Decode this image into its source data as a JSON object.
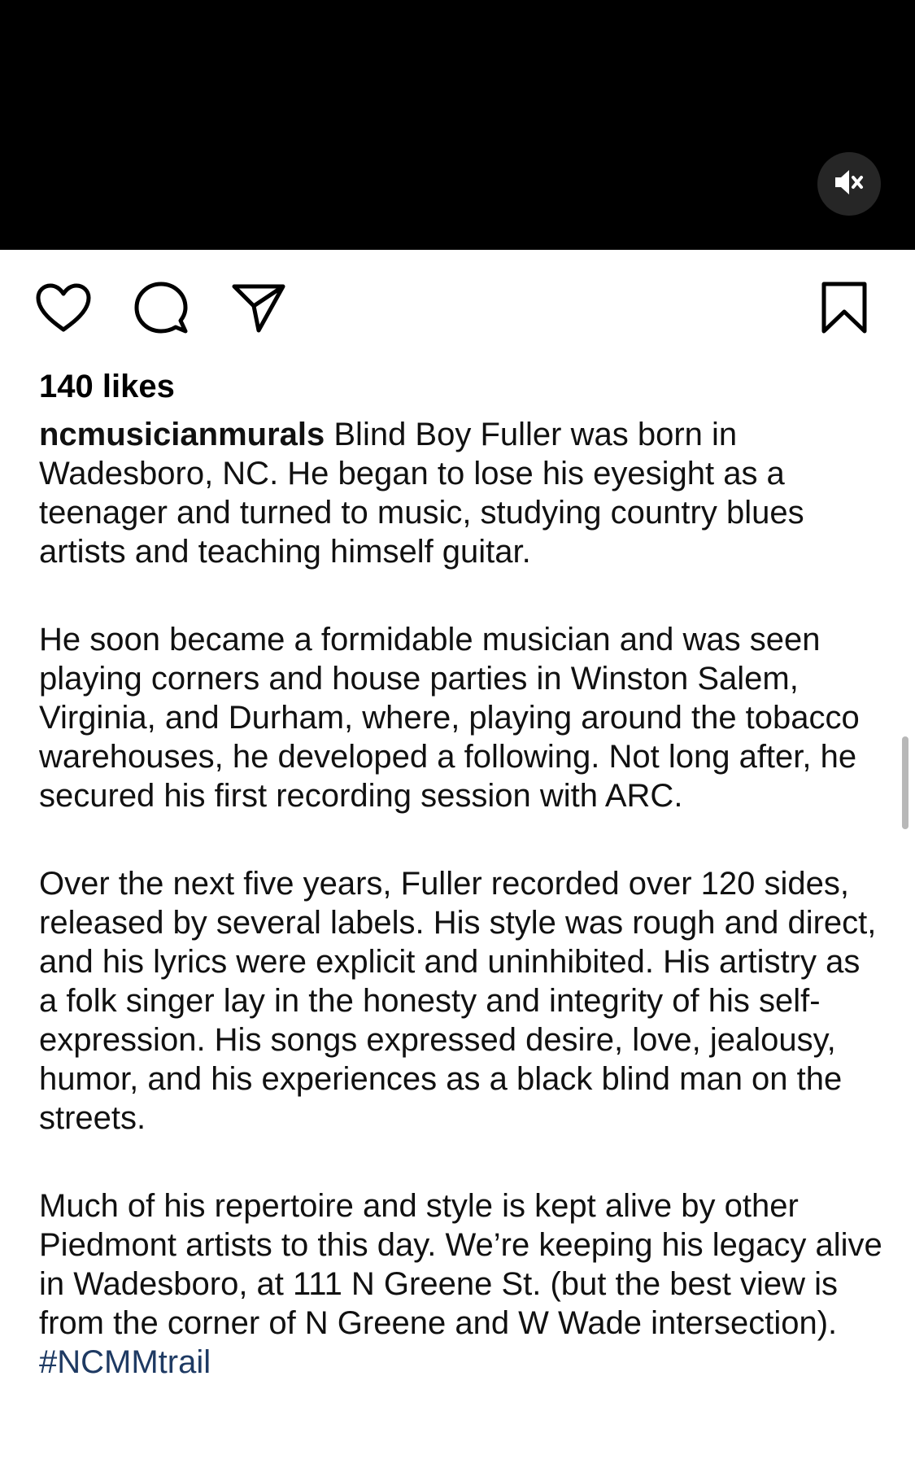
{
  "post": {
    "likes_text": "140 likes",
    "username": "ncmusicianmurals",
    "paragraphs": [
      "Blind Boy Fuller was born in Wadesboro, NC. He began to lose his eyesight as a teenager and turned to music, studying country blues artists and teaching himself guitar.",
      "He soon became a formidable musician and was seen playing corners and house parties in Winston Salem, Virginia, and Durham, where, playing around the tobacco warehouses, he developed a following. Not long after, he secured his first recording session with ARC.",
      "Over the next five years, Fuller recorded over 120 sides, released by several labels. His style was rough and direct, and his lyrics were explicit and uninhibited. His artistry as a folk singer lay in the honesty and integrity of his self-expression. His songs expressed desire, love, jealousy, humor, and his experiences as a black blind man on the streets.",
      "Much of his repertoire and style is kept alive by other Piedmont artists to this day. We’re keeping his legacy alive in Wadesboro, at 111 N Greene St. (but the best view is from the corner of N Greene and W Wade intersection)."
    ],
    "hashtag": "#NCMMtrail"
  },
  "icons": {
    "mute": "speaker-muted-icon",
    "like": "heart-icon",
    "comment": "comment-bubble-icon",
    "share": "paper-plane-icon",
    "save": "bookmark-icon"
  },
  "colors": {
    "hashtag": "#1e3a63",
    "video_bg": "#000000",
    "mute_bg": "#262626"
  }
}
